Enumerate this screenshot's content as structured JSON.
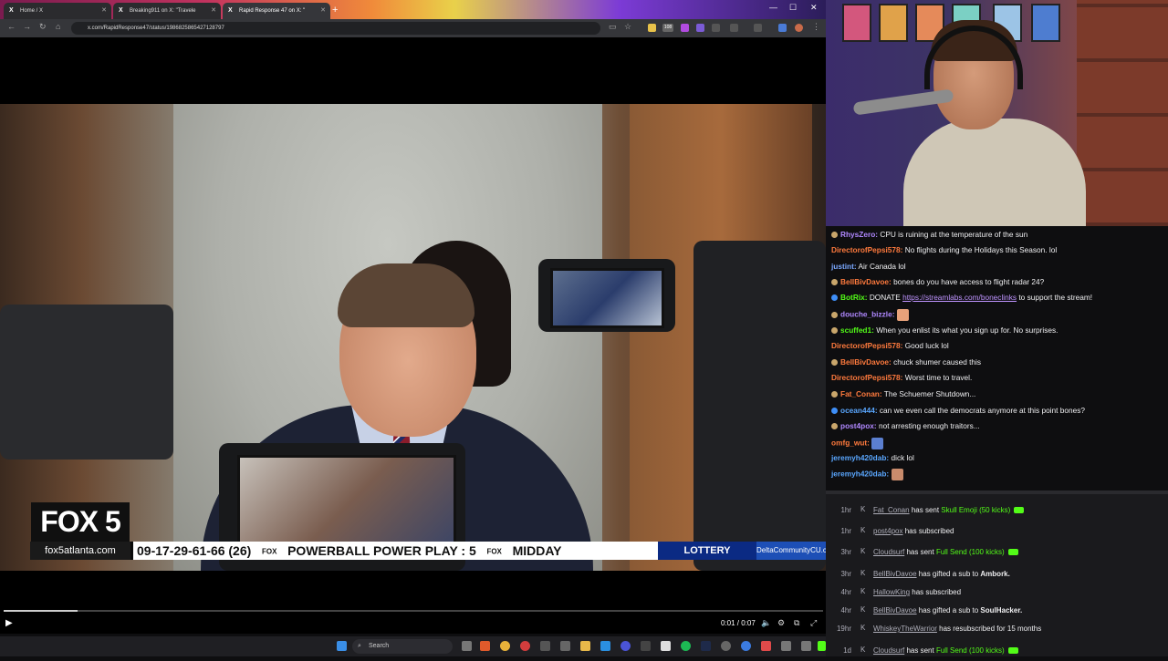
{
  "browser": {
    "tabs": [
      {
        "title": "Home / X"
      },
      {
        "title": "Breaking911 on X: \"Travele"
      },
      {
        "title": "Rapid Response 47 on X: \""
      }
    ],
    "url": "x.com/RapidResponse47/status/1986825865427128797",
    "ext_badge": "108"
  },
  "video": {
    "network_logo": "FOX 5",
    "website": "fox5atlanta.com",
    "ticker": "09-17-29-61-66 (26)",
    "ticker_logo1": "FOX",
    "ticker_powerball": "POWERBALL POWER PLAY : 5",
    "ticker_logo2": "FOX",
    "ticker_midday": "MIDDAY",
    "lottery_label": "LOTTERY",
    "sponsor": "DeltaCommunityCU.com",
    "time": "0:01 / 0:07",
    "progress_fraction": 0.09
  },
  "taskbar": {
    "search_placeholder": "Search"
  },
  "chat": [
    {
      "user": "RhysZero:",
      "color": "#b088ff",
      "badge": "#c9a66b",
      "text": "CPU is ruining at the temperature of the sun"
    },
    {
      "user": "DirectorofPepsi578:",
      "color": "#ff7a3d",
      "badge": "",
      "text": "No flights during the Holidays this Season. lol"
    },
    {
      "user": "justint:",
      "color": "#7aa8ff",
      "badge": "",
      "text": "Air Canada lol"
    },
    {
      "user": "BellBivDavoe:",
      "color": "#ff7a3d",
      "badge": "#c9a66b",
      "text": "bones do you have access to flight radar 24?"
    },
    {
      "user": "BotRix:",
      "color": "#53fc18",
      "badge": "#3e8ef7",
      "text": "DONATE ",
      "link": "https://streamlabs.com/boneclinks",
      "after": " to support the stream!"
    },
    {
      "user": "douche_bizzle:",
      "color": "#b088ff",
      "badge": "#c9a66b",
      "text": "",
      "emote": "face-emote"
    },
    {
      "user": "scuffed1:",
      "color": "#53fc18",
      "badge": "#c9a66b",
      "text": "When you enlist its what you sign up for. No surprises."
    },
    {
      "user": "DirectorofPepsi578:",
      "color": "#ff7a3d",
      "badge": "",
      "text": "Good luck lol"
    },
    {
      "user": "BellBivDavoe:",
      "color": "#ff7a3d",
      "badge": "#c9a66b",
      "text": "chuck shumer caused this"
    },
    {
      "user": "DirectorofPepsi578:",
      "color": "#ff7a3d",
      "badge": "",
      "text": "Worst time to travel."
    },
    {
      "user": "Fat_Conan:",
      "color": "#ff7a3d",
      "badge": "#c9a66b",
      "text": "The Schuemer Shutdown..."
    },
    {
      "user": "ocean444:",
      "color": "#5aa7ff",
      "badge": "#3e8ef7",
      "text": "can we even call the democrats anymore at this point bones?"
    },
    {
      "user": "post4pox:",
      "color": "#b088ff",
      "badge": "#c9a66b",
      "text": "not arresting enough traitors..."
    },
    {
      "user": "omfg_wut:",
      "color": "#ff7a3d",
      "badge": "",
      "text": "",
      "emote": "cat-emote"
    },
    {
      "user": "jeremyh420dab:",
      "color": "#5aa7ff",
      "badge": "",
      "text": "dick lol"
    },
    {
      "user": "jeremyh420dab:",
      "color": "#5aa7ff",
      "badge": "",
      "text": "",
      "emote": "hand-emote"
    }
  ],
  "events": [
    {
      "time": "1hr",
      "user": "Fat_Conan",
      "pre": " has sent ",
      "item": "Skull Emoji (50 kicks)",
      "item_color": "green",
      "money": true
    },
    {
      "time": "1hr",
      "user": "post4pox",
      "pre": " has subscribed",
      "item": "",
      "money": false
    },
    {
      "time": "3hr",
      "user": "Cloudsurf",
      "pre": " has sent ",
      "item": "Full Send (100 kicks)",
      "item_color": "green",
      "money": true
    },
    {
      "time": "3hr",
      "user": "BellBivDavoe",
      "pre": " has gifted a sub to ",
      "item": "Ambork.",
      "item_color": "bold",
      "money": false
    },
    {
      "time": "4hr",
      "user": "HallowKing",
      "pre": " has subscribed",
      "item": "",
      "money": false
    },
    {
      "time": "4hr",
      "user": "BellBivDavoe",
      "pre": " has gifted a sub to ",
      "item": "SoulHacker.",
      "item_color": "bold",
      "money": false
    },
    {
      "time": "19hr",
      "user": "WhiskeyTheWarrior",
      "pre": " has resubscribed for 15 months",
      "item": "",
      "money": false
    },
    {
      "time": "1d",
      "user": "Cloudsurf",
      "pre": " has sent ",
      "item": "Full Send (100 kicks)",
      "item_color": "green",
      "money": true
    }
  ]
}
